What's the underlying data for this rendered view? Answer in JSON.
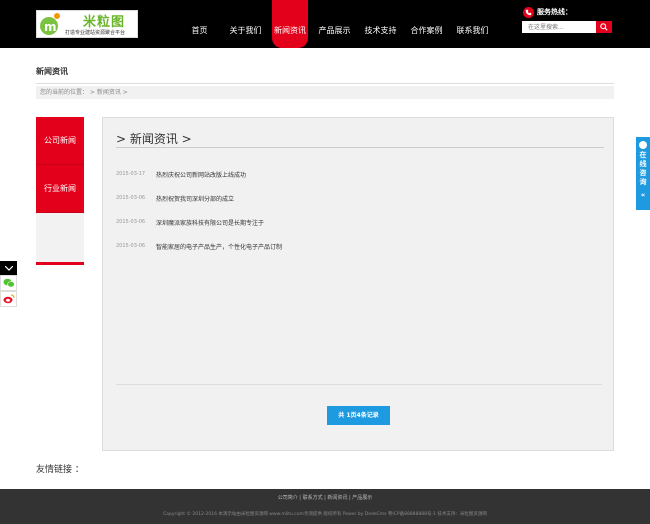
{
  "logo": {
    "name": "米粒图",
    "tagline": "打造专业建站资源聚合平台"
  },
  "nav": {
    "items": [
      {
        "label": "首页"
      },
      {
        "label": "关于我们"
      },
      {
        "label": "新闻资讯",
        "active": true
      },
      {
        "label": "产品展示"
      },
      {
        "label": "技术支持"
      },
      {
        "label": "合作案例"
      },
      {
        "label": "联系我们"
      }
    ]
  },
  "hotline": {
    "label": "服务热线："
  },
  "search": {
    "placeholder": "在这里搜索..."
  },
  "page": {
    "title": "新闻资讯",
    "breadcrumb": "您的当前的位置： > 新闻资讯 >"
  },
  "sidebar": {
    "items": [
      {
        "label": "公司新闻"
      },
      {
        "label": "行业新闻"
      }
    ]
  },
  "panel": {
    "title": "> 新闻资讯 >",
    "news": [
      {
        "date": "2015-03-17",
        "title": "热烈庆祝公司新网站改版上线成功"
      },
      {
        "date": "2015-03-06",
        "title": "热烈祝贺我司深圳分部的成立"
      },
      {
        "date": "2015-03-06",
        "title": "深圳魔派家族科技有限公司是长期专注于"
      },
      {
        "date": "2015-03-06",
        "title": "智能家居的电子产品生产，个性化电子产品订制"
      }
    ],
    "pager": "共 1页4条记录"
  },
  "friend_links": {
    "label": "友情链接 ："
  },
  "footer": {
    "links": "公司简介 | 联系方式 | 新闻资讯 | 产品展示",
    "copyright": "Copyright © 2012-2016 本演示站由米粒图资源网 www.mlitu.com亲测提供 版权所有  Power by DedeCms 粤ICP备88888888号-1 技术支持：米粒图资源网"
  },
  "consult": {
    "label": "在线咨询",
    "arrow": "«"
  },
  "colors": {
    "brand": "#e3001b",
    "accent_blue": "#1e9ae0",
    "header_bg": "#000000",
    "footer_bg": "#333333"
  }
}
